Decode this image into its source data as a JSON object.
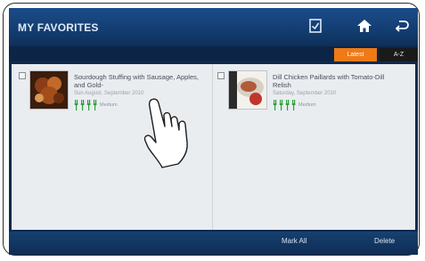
{
  "header": {
    "title": "MY FAVORITES",
    "icons": [
      "clipboard-check-icon",
      "home-icon",
      "back-icon"
    ]
  },
  "sort_tabs": {
    "latest": "Latest",
    "az": "A-Z",
    "active": "Latest",
    "active_color": "#ef7a16"
  },
  "recipes": [
    {
      "title": "Sourdough Stuffing with Sausage, Apples, and Gold-",
      "date": "Sun August, September 2010",
      "utensil_label": "Medium",
      "difficulty": 4
    },
    {
      "title": "Dill Chicken Paillards with Tomato-Dill Relish",
      "date": "Saturday, September 2010",
      "utensil_label": "Medium",
      "difficulty": 4
    }
  ],
  "footer": {
    "mark_all": "Mark All",
    "delete": "Delete"
  },
  "colors": {
    "header_blue": "#1b4d8a",
    "utensil_green": "#2e9e3a",
    "panel": "#e9edf0"
  }
}
